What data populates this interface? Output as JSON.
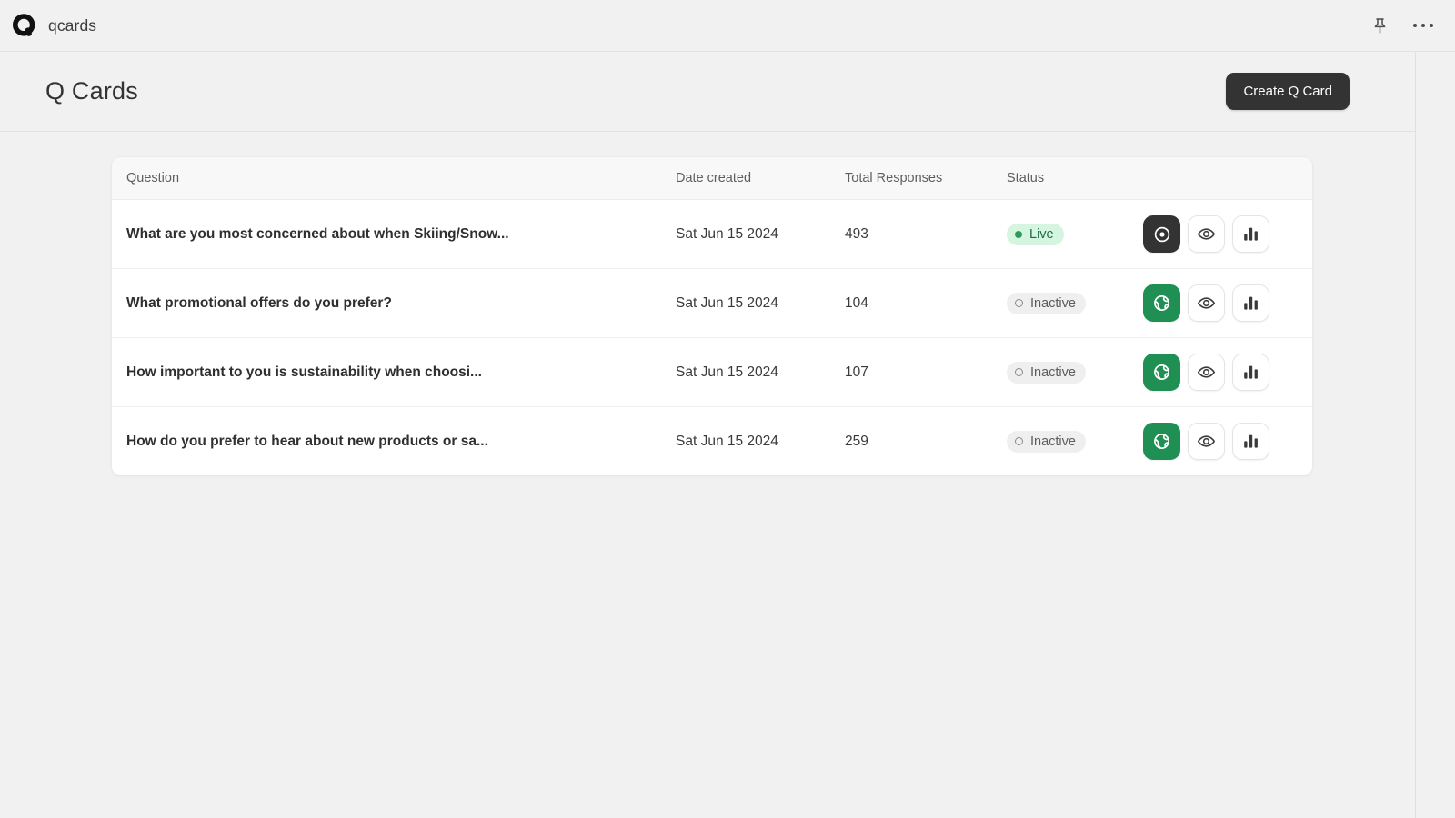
{
  "app": {
    "brand_name": "qcards",
    "logo_glyph": "Q",
    "pin_icon": "pushpin-icon",
    "more_icon": "more-options-icon"
  },
  "header": {
    "title": "Q Cards",
    "create_button": "Create Q Card"
  },
  "table": {
    "columns": {
      "question": "Question",
      "date": "Date created",
      "responses": "Total Responses",
      "status": "Status",
      "actions": ""
    },
    "rows": [
      {
        "question": "What are you most concerned about when Skiing/Snow...",
        "date": "Sat Jun 15 2024",
        "responses": "493",
        "status": "Live",
        "status_type": "live",
        "primary_action": "target-icon",
        "primary_state": "dark",
        "actions": [
          "eye-icon",
          "bar-chart-icon"
        ]
      },
      {
        "question": "What promotional offers do you prefer?",
        "date": "Sat Jun 15 2024",
        "responses": "104",
        "status": "Inactive",
        "status_type": "inactive",
        "primary_action": "globe-icon",
        "primary_state": "green",
        "actions": [
          "eye-icon",
          "bar-chart-icon"
        ]
      },
      {
        "question": "How important to you is sustainability when choosi...",
        "date": "Sat Jun 15 2024",
        "responses": "107",
        "status": "Inactive",
        "status_type": "inactive",
        "primary_action": "globe-icon",
        "primary_state": "green",
        "actions": [
          "eye-icon",
          "bar-chart-icon"
        ]
      },
      {
        "question": "How do you prefer to hear about new products or sa...",
        "date": "Sat Jun 15 2024",
        "responses": "259",
        "status": "Inactive",
        "status_type": "inactive",
        "primary_action": "globe-icon",
        "primary_state": "green",
        "actions": [
          "eye-icon",
          "bar-chart-icon"
        ]
      }
    ]
  },
  "colors": {
    "page_bg": "#f1f1f1",
    "accent_dark": "#333333",
    "accent_green": "#1f8f54",
    "live_badge_bg": "#d6f5e0",
    "live_badge_text": "#1d6c3f",
    "inactive_badge_bg": "#efefef",
    "inactive_badge_text": "#5c5c5c"
  }
}
